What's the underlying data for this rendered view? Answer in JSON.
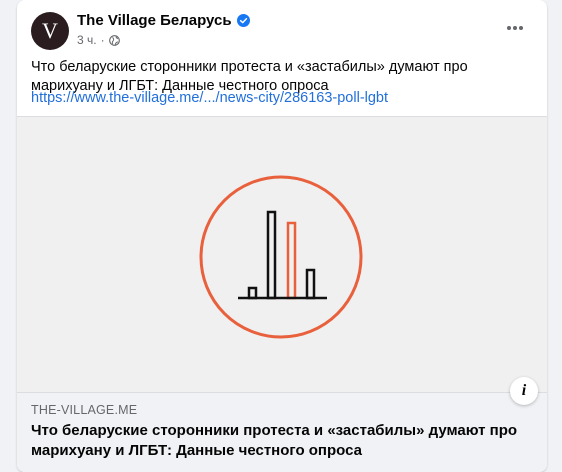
{
  "post": {
    "avatar_letter": "V",
    "page_name": "The Village Беларусь",
    "time": "3 ч.",
    "separator": "·",
    "text": "Что беларуские сторонники протеста и «застабилы» думают про марихуану и ЛГБТ: Данные честного опроса",
    "link": "https://www.the-village.me/.../news-city/286163-poll-lgbt"
  },
  "link_preview": {
    "domain": "THE-VILLAGE.ME",
    "title": "Что беларуские сторонники протеста и «застабилы» думают про марихуану и ЛГБТ: Данные честного опроса",
    "info_label": "i"
  },
  "colors": {
    "accent_orange": "#e8603c",
    "link_blue": "#216fdb",
    "verified_blue": "#1877f2"
  },
  "icons": {
    "verified": "verified-badge-icon",
    "privacy": "globe-icon",
    "menu": "more-options-icon",
    "illustration": "bar-chart-in-circle-icon"
  }
}
